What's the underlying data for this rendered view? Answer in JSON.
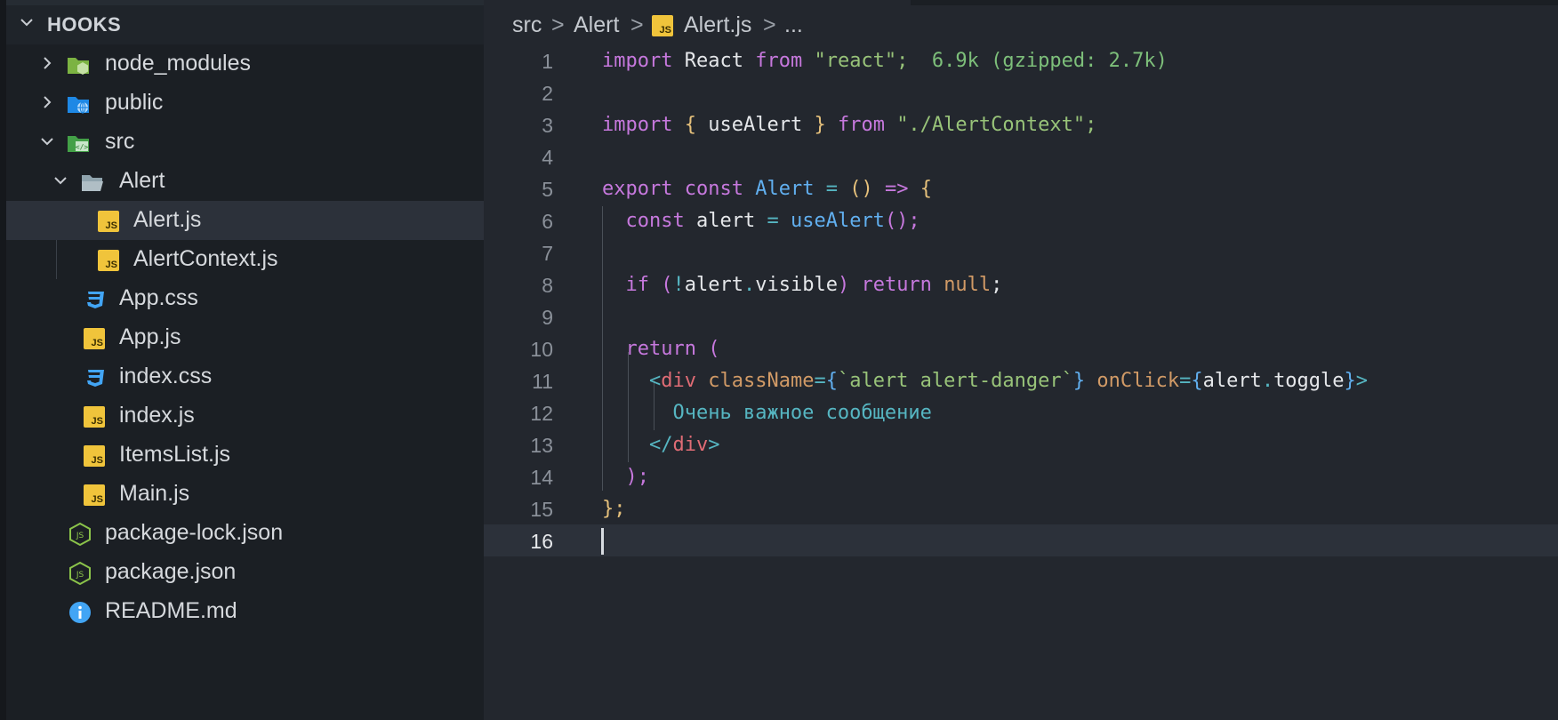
{
  "explorer": {
    "title": "HOOKS",
    "items": [
      {
        "label": "node_modules",
        "icon": "node-folder-icon"
      },
      {
        "label": "public",
        "icon": "public-folder-icon"
      },
      {
        "label": "src",
        "icon": "src-folder-icon"
      },
      {
        "label": "Alert",
        "icon": "folder-open-icon"
      },
      {
        "label": "Alert.js",
        "icon": "js-file-icon"
      },
      {
        "label": "AlertContext.js",
        "icon": "js-file-icon"
      },
      {
        "label": "App.css",
        "icon": "css-file-icon"
      },
      {
        "label": "App.js",
        "icon": "js-file-icon"
      },
      {
        "label": "index.css",
        "icon": "css-file-icon"
      },
      {
        "label": "index.js",
        "icon": "js-file-icon"
      },
      {
        "label": "ItemsList.js",
        "icon": "js-file-icon"
      },
      {
        "label": "Main.js",
        "icon": "js-file-icon"
      },
      {
        "label": "package-lock.json",
        "icon": "npm-json-icon"
      },
      {
        "label": "package.json",
        "icon": "npm-json-icon"
      },
      {
        "label": "README.md",
        "icon": "info-icon"
      }
    ]
  },
  "breadcrumb": {
    "parts": [
      "src",
      "Alert",
      "Alert.js",
      "..."
    ],
    "separator": ">",
    "js_badge": "JS"
  },
  "editor": {
    "line_numbers": [
      "1",
      "2",
      "3",
      "4",
      "5",
      "6",
      "7",
      "8",
      "9",
      "10",
      "11",
      "12",
      "13",
      "14",
      "15",
      "16"
    ],
    "current_line": 16,
    "tokens": {
      "import": "import",
      "react_id": "React",
      "from": "from",
      "react_str": "\"react\";",
      "size_hint": "6.9k (gzipped: 2.7k)",
      "lbrace": "{",
      "useAlert": "useAlert",
      "rbrace": "}",
      "ctx_str": "\"./AlertContext\";",
      "export": "export",
      "const": "const",
      "alert_comp": "Alert",
      "eq": "=",
      "parens": "()",
      "arrow": "=>",
      "alert_var": "alert",
      "call": "useAlert",
      "call_parens": "();",
      "if": "if",
      "paren_open": "(",
      "not": "!",
      "visible": "visible",
      "paren_close": ")",
      "return": "return",
      "null": "null",
      "semi": ";",
      "dot": ".",
      "lt": "<",
      "div": "div",
      "className": "className",
      "template": "`alert alert-danger`",
      "onClick": "onClick",
      "toggle": "toggle",
      "gt": ">",
      "text": "Очень важное сообщение",
      "close_tag_open": "</",
      "close_paren": ");",
      "end": "};"
    }
  },
  "colors": {
    "keyword": "#c678dd",
    "string": "#98c379",
    "function": "#61afef",
    "tag": "#e06c75",
    "attribute": "#d19a66",
    "bracket": "#e5c07b",
    "js_badge": "#f0c43b"
  }
}
